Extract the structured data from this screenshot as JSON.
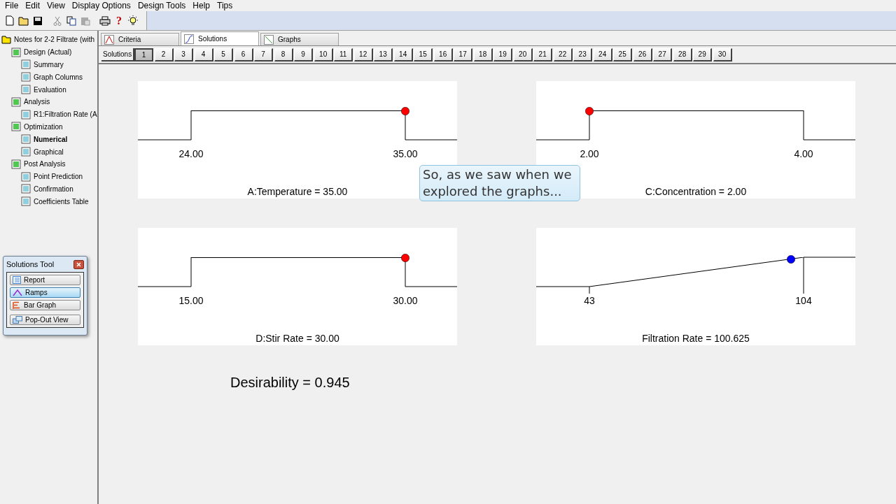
{
  "menu": [
    "File",
    "Edit",
    "View",
    "Display Options",
    "Design Tools",
    "Help",
    "Tips"
  ],
  "toolbar": [
    {
      "kind": "new"
    },
    {
      "kind": "open"
    },
    {
      "kind": "save"
    },
    {
      "kind": "cut"
    },
    {
      "kind": "copy"
    },
    {
      "kind": "paste"
    },
    {
      "kind": "print"
    },
    {
      "kind": "help",
      "label": "?"
    },
    {
      "kind": "tip"
    }
  ],
  "tree": {
    "label": "Notes for 2-2 Filtrate (with",
    "selected": false,
    "children": [
      {
        "label": "Design (Actual)",
        "selected": false,
        "children": [
          {
            "label": "Summary",
            "selected": false
          },
          {
            "label": "Graph Columns",
            "selected": false
          },
          {
            "label": "Evaluation",
            "selected": false
          }
        ]
      },
      {
        "label": "Analysis",
        "selected": false,
        "children": [
          {
            "label": "R1:Filtration Rate (A",
            "selected": false
          }
        ]
      },
      {
        "label": "Optimization",
        "selected": false,
        "children": [
          {
            "label": "Numerical",
            "selected": true
          },
          {
            "label": "Graphical",
            "selected": false
          }
        ]
      },
      {
        "label": "Post Analysis",
        "selected": false,
        "children": [
          {
            "label": "Point Prediction",
            "selected": false
          },
          {
            "label": "Confirmation",
            "selected": false
          },
          {
            "label": "Coefficients Table",
            "selected": false
          }
        ]
      }
    ]
  },
  "solutions_tool": {
    "title": "Solutions Tool",
    "buttons": [
      {
        "label": "Report",
        "selected": false
      },
      {
        "label": "Ramps",
        "selected": true
      },
      {
        "label": "Bar Graph",
        "selected": false
      },
      {
        "label": "Pop-Out View",
        "selected": false
      }
    ]
  },
  "tabs": [
    {
      "label": "Criteria",
      "selected": false
    },
    {
      "label": "Solutions",
      "selected": true
    },
    {
      "label": "Graphs",
      "selected": false
    }
  ],
  "solutions_bar": {
    "label": "Solutions",
    "items": [
      {
        "label": "1",
        "selected": true
      },
      {
        "label": "2",
        "selected": false
      },
      {
        "label": "3",
        "selected": false
      },
      {
        "label": "4",
        "selected": false
      },
      {
        "label": "5",
        "selected": false
      },
      {
        "label": "6",
        "selected": false
      },
      {
        "label": "7",
        "selected": false
      },
      {
        "label": "8",
        "selected": false
      },
      {
        "label": "9",
        "selected": false
      },
      {
        "label": "10",
        "selected": false
      },
      {
        "label": "11",
        "selected": false
      },
      {
        "label": "12",
        "selected": false
      },
      {
        "label": "13",
        "selected": false
      },
      {
        "label": "14",
        "selected": false
      },
      {
        "label": "15",
        "selected": false
      },
      {
        "label": "16",
        "selected": false
      },
      {
        "label": "17",
        "selected": false
      },
      {
        "label": "18",
        "selected": false
      },
      {
        "label": "19",
        "selected": false
      },
      {
        "label": "20",
        "selected": false
      },
      {
        "label": "21",
        "selected": false
      },
      {
        "label": "22",
        "selected": false
      },
      {
        "label": "23",
        "selected": false
      },
      {
        "label": "24",
        "selected": false
      },
      {
        "label": "25",
        "selected": false
      },
      {
        "label": "26",
        "selected": false
      },
      {
        "label": "27",
        "selected": false
      },
      {
        "label": "28",
        "selected": false
      },
      {
        "label": "29",
        "selected": false
      },
      {
        "label": "30",
        "selected": false
      }
    ]
  },
  "ramps": [
    {
      "kind": "range",
      "low": "24.00",
      "high": "35.00",
      "title": "A:Temperature = 35.00",
      "level": 1,
      "color": "#ff0000"
    },
    {
      "kind": "range",
      "low": "2.00",
      "high": "4.00",
      "title": "C:Concentration = 2.00",
      "level": 0,
      "color": "#ff0000"
    },
    {
      "kind": "range",
      "low": "15.00",
      "high": "30.00",
      "title": "D:Stir Rate = 30.00",
      "level": 1,
      "color": "#ff0000"
    },
    {
      "kind": "maximize",
      "low": "43",
      "high": "104",
      "title": "Filtration Rate = 100.625",
      "level": 0.94,
      "color": "#0000ff"
    }
  ],
  "desirability": "Desirability = 0.945",
  "callout": "So, as we saw when we explored the graphs..."
}
